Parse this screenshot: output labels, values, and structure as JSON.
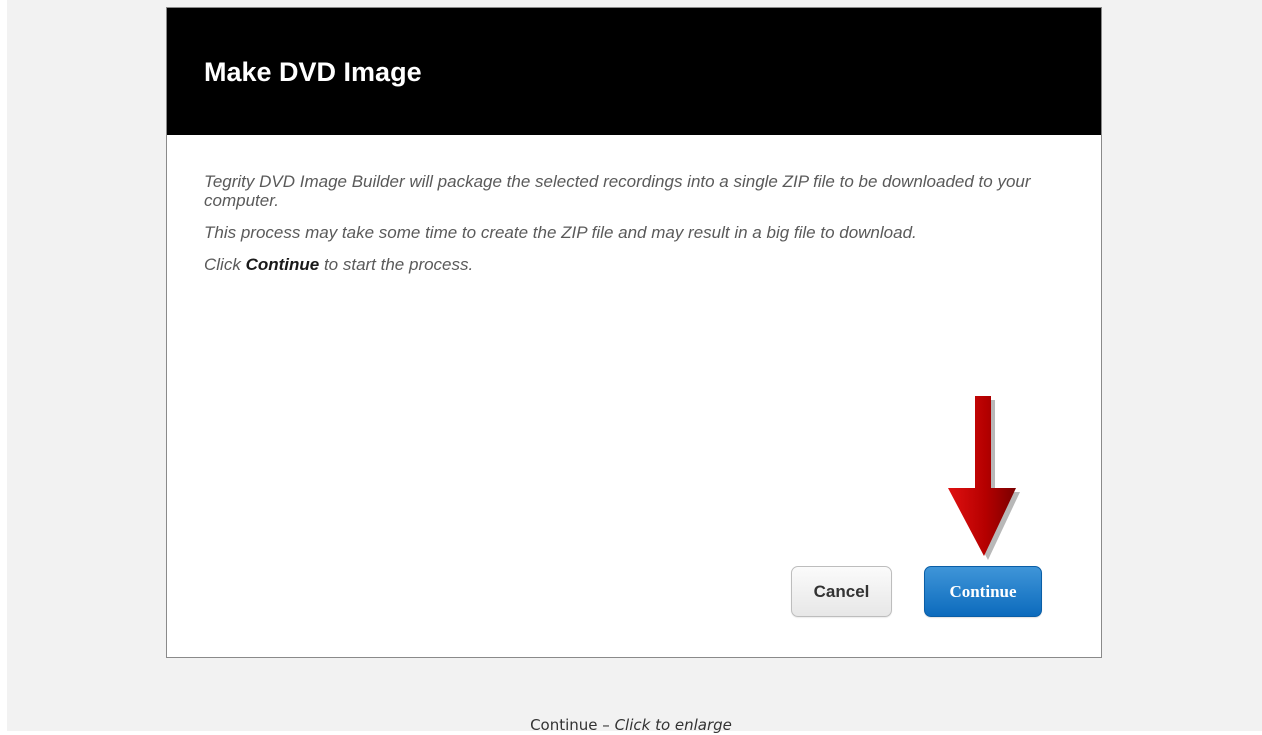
{
  "dialog": {
    "title": "Make DVD Image",
    "paragraph_1": "Tegrity DVD Image Builder will package the selected recordings into a single ZIP file to be downloaded to your computer.",
    "paragraph_2": "This process may take some time to create the ZIP file and may result in a big file to download.",
    "paragraph_3_prefix": "Click ",
    "paragraph_3_emphasis": "Continue",
    "paragraph_3_suffix": " to start the process.",
    "cancel_label": "Cancel",
    "continue_label": "Continue"
  },
  "annotation": {
    "icon": "down-arrow-icon",
    "color": "#c00000"
  },
  "caption": {
    "prefix": "Continue – ",
    "link": "Click to enlarge"
  },
  "colors": {
    "header_bg": "#000000",
    "continue_button": "#1a78c8",
    "page_bg": "#f2f2f2"
  }
}
